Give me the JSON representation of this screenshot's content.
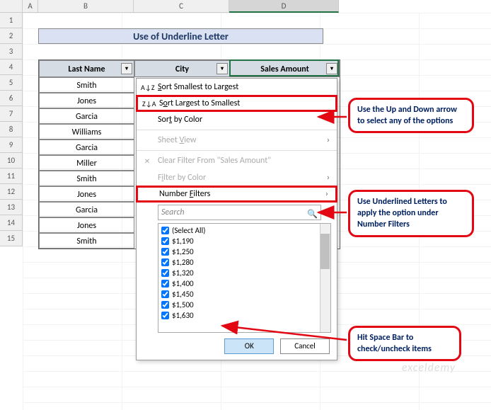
{
  "columns": {
    "A": "A",
    "B": "B",
    "C": "C",
    "D": "D"
  },
  "col_widths": {
    "A": 22,
    "B": 135,
    "C": 135,
    "D": 155
  },
  "rows": [
    "1",
    "2",
    "3",
    "4",
    "5",
    "6",
    "7",
    "8",
    "9",
    "10",
    "11",
    "12",
    "13",
    "14",
    "15"
  ],
  "title": "Use of Underline Letter",
  "table": {
    "headers": {
      "b": "Last Name",
      "c": "City",
      "d": "Sales Amount"
    },
    "data_b": [
      "Smith",
      "Jones",
      "Garcia",
      "Williams",
      "Garcia",
      "Miller",
      "Smith",
      "Jones",
      "Garcia",
      "Jones",
      "Smith"
    ]
  },
  "dropdown": {
    "sort_asc": "Sort Smallest to Largest",
    "sort_desc": "Sort Largest to Smallest",
    "sort_color": "Sort by Color",
    "sheet_view": "Sheet View",
    "clear_filter": "Clear Filter From \"Sales Amount\"",
    "filter_color": "Filter by Color",
    "number_filters": "Number Filters",
    "search_placeholder": "Search",
    "select_all": "(Select All)",
    "values": [
      "$1,190",
      "$1,250",
      "$1,280",
      "$1,320",
      "$1,400",
      "$1,450",
      "$1,500",
      "$1,630"
    ],
    "ok": "OK",
    "cancel": "Cancel"
  },
  "callouts": {
    "c1": "Use the Up and Down arrow to select any of the options",
    "c2": "Use Underlined Letters to apply the option under Number Filters",
    "c3": "Hit Space Bar to check/uncheck items"
  },
  "watermark": "exceldemy"
}
